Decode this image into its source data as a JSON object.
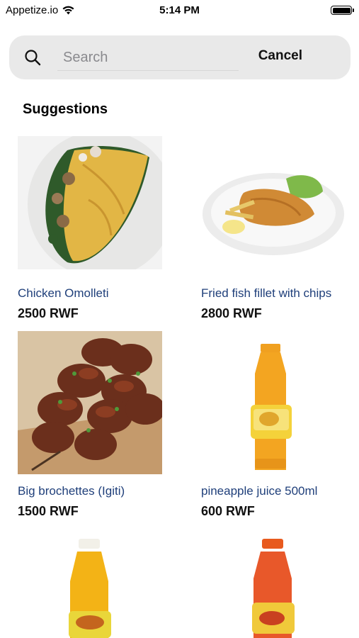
{
  "status_bar": {
    "carrier": "Appetize.io",
    "time": "5:14 PM",
    "wifi_icon": "wifi-icon",
    "battery_icon": "battery-icon"
  },
  "search": {
    "placeholder": "Search",
    "value": "",
    "cancel_label": "Cancel",
    "icon": "search-icon"
  },
  "section": {
    "title": "Suggestions"
  },
  "products": [
    {
      "name": "Chicken Omolleti",
      "price": "2500 RWF"
    },
    {
      "name": "Fried fish fillet with chips",
      "price": "2800 RWF"
    },
    {
      "name": "Big brochettes (Igiti)",
      "price": "1500 RWF"
    },
    {
      "name": "pineapple juice 500ml",
      "price": "600 RWF"
    },
    {
      "name": "",
      "price": ""
    },
    {
      "name": "",
      "price": ""
    }
  ],
  "colors": {
    "product_name": "#1f3f7a",
    "search_bg": "#e9e9e9"
  }
}
